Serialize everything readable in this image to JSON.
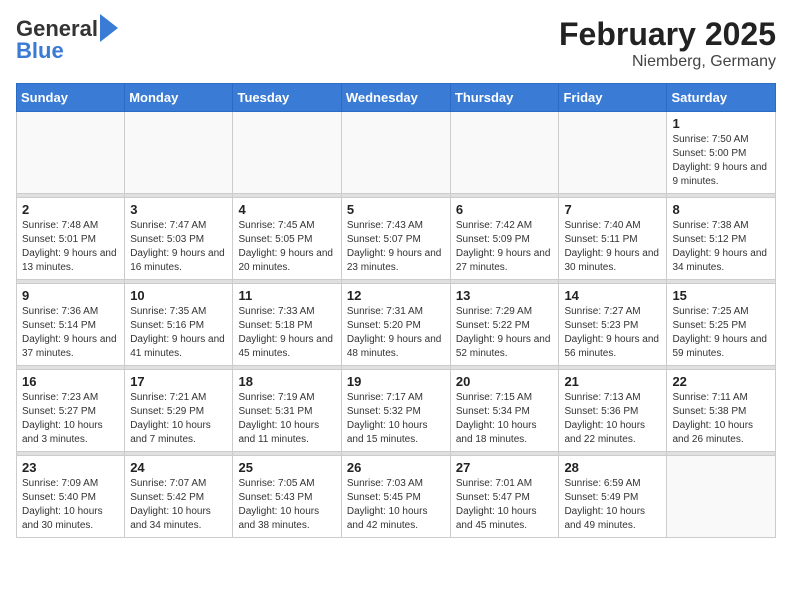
{
  "header": {
    "logo_line1": "General",
    "logo_line2": "Blue",
    "month_title": "February 2025",
    "location": "Niemberg, Germany"
  },
  "weekdays": [
    "Sunday",
    "Monday",
    "Tuesday",
    "Wednesday",
    "Thursday",
    "Friday",
    "Saturday"
  ],
  "weeks": [
    [
      {
        "day": "",
        "info": ""
      },
      {
        "day": "",
        "info": ""
      },
      {
        "day": "",
        "info": ""
      },
      {
        "day": "",
        "info": ""
      },
      {
        "day": "",
        "info": ""
      },
      {
        "day": "",
        "info": ""
      },
      {
        "day": "1",
        "info": "Sunrise: 7:50 AM\nSunset: 5:00 PM\nDaylight: 9 hours and 9 minutes."
      }
    ],
    [
      {
        "day": "2",
        "info": "Sunrise: 7:48 AM\nSunset: 5:01 PM\nDaylight: 9 hours and 13 minutes."
      },
      {
        "day": "3",
        "info": "Sunrise: 7:47 AM\nSunset: 5:03 PM\nDaylight: 9 hours and 16 minutes."
      },
      {
        "day": "4",
        "info": "Sunrise: 7:45 AM\nSunset: 5:05 PM\nDaylight: 9 hours and 20 minutes."
      },
      {
        "day": "5",
        "info": "Sunrise: 7:43 AM\nSunset: 5:07 PM\nDaylight: 9 hours and 23 minutes."
      },
      {
        "day": "6",
        "info": "Sunrise: 7:42 AM\nSunset: 5:09 PM\nDaylight: 9 hours and 27 minutes."
      },
      {
        "day": "7",
        "info": "Sunrise: 7:40 AM\nSunset: 5:11 PM\nDaylight: 9 hours and 30 minutes."
      },
      {
        "day": "8",
        "info": "Sunrise: 7:38 AM\nSunset: 5:12 PM\nDaylight: 9 hours and 34 minutes."
      }
    ],
    [
      {
        "day": "9",
        "info": "Sunrise: 7:36 AM\nSunset: 5:14 PM\nDaylight: 9 hours and 37 minutes."
      },
      {
        "day": "10",
        "info": "Sunrise: 7:35 AM\nSunset: 5:16 PM\nDaylight: 9 hours and 41 minutes."
      },
      {
        "day": "11",
        "info": "Sunrise: 7:33 AM\nSunset: 5:18 PM\nDaylight: 9 hours and 45 minutes."
      },
      {
        "day": "12",
        "info": "Sunrise: 7:31 AM\nSunset: 5:20 PM\nDaylight: 9 hours and 48 minutes."
      },
      {
        "day": "13",
        "info": "Sunrise: 7:29 AM\nSunset: 5:22 PM\nDaylight: 9 hours and 52 minutes."
      },
      {
        "day": "14",
        "info": "Sunrise: 7:27 AM\nSunset: 5:23 PM\nDaylight: 9 hours and 56 minutes."
      },
      {
        "day": "15",
        "info": "Sunrise: 7:25 AM\nSunset: 5:25 PM\nDaylight: 9 hours and 59 minutes."
      }
    ],
    [
      {
        "day": "16",
        "info": "Sunrise: 7:23 AM\nSunset: 5:27 PM\nDaylight: 10 hours and 3 minutes."
      },
      {
        "day": "17",
        "info": "Sunrise: 7:21 AM\nSunset: 5:29 PM\nDaylight: 10 hours and 7 minutes."
      },
      {
        "day": "18",
        "info": "Sunrise: 7:19 AM\nSunset: 5:31 PM\nDaylight: 10 hours and 11 minutes."
      },
      {
        "day": "19",
        "info": "Sunrise: 7:17 AM\nSunset: 5:32 PM\nDaylight: 10 hours and 15 minutes."
      },
      {
        "day": "20",
        "info": "Sunrise: 7:15 AM\nSunset: 5:34 PM\nDaylight: 10 hours and 18 minutes."
      },
      {
        "day": "21",
        "info": "Sunrise: 7:13 AM\nSunset: 5:36 PM\nDaylight: 10 hours and 22 minutes."
      },
      {
        "day": "22",
        "info": "Sunrise: 7:11 AM\nSunset: 5:38 PM\nDaylight: 10 hours and 26 minutes."
      }
    ],
    [
      {
        "day": "23",
        "info": "Sunrise: 7:09 AM\nSunset: 5:40 PM\nDaylight: 10 hours and 30 minutes."
      },
      {
        "day": "24",
        "info": "Sunrise: 7:07 AM\nSunset: 5:42 PM\nDaylight: 10 hours and 34 minutes."
      },
      {
        "day": "25",
        "info": "Sunrise: 7:05 AM\nSunset: 5:43 PM\nDaylight: 10 hours and 38 minutes."
      },
      {
        "day": "26",
        "info": "Sunrise: 7:03 AM\nSunset: 5:45 PM\nDaylight: 10 hours and 42 minutes."
      },
      {
        "day": "27",
        "info": "Sunrise: 7:01 AM\nSunset: 5:47 PM\nDaylight: 10 hours and 45 minutes."
      },
      {
        "day": "28",
        "info": "Sunrise: 6:59 AM\nSunset: 5:49 PM\nDaylight: 10 hours and 49 minutes."
      },
      {
        "day": "",
        "info": ""
      }
    ]
  ]
}
